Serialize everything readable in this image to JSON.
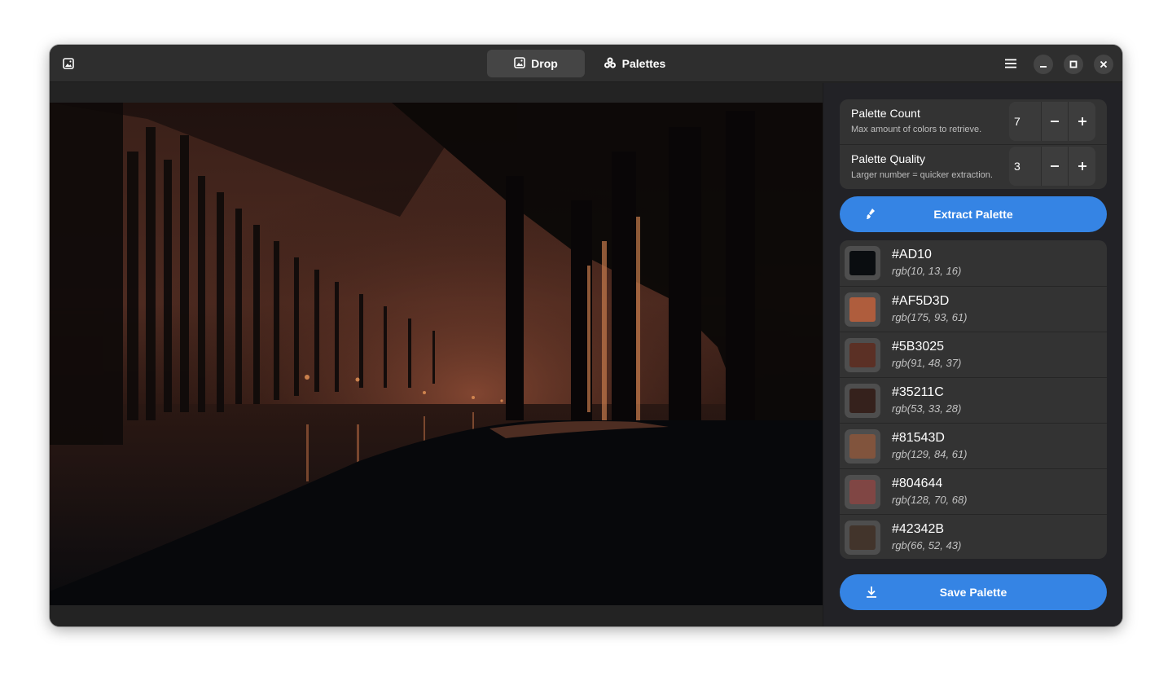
{
  "header": {
    "app_icon": "image-icon",
    "tabs": [
      {
        "label": "Drop",
        "icon": "image-icon",
        "active": true
      },
      {
        "label": "Palettes",
        "icon": "palette-icon",
        "active": false
      }
    ],
    "controls": [
      "menu-icon",
      "minimize-icon",
      "maximize-icon",
      "close-icon"
    ]
  },
  "settings": {
    "count": {
      "title": "Palette Count",
      "subtitle": "Max amount of colors to retrieve.",
      "value": "7"
    },
    "quality": {
      "title": "Palette Quality",
      "subtitle": "Larger number = quicker extraction.",
      "value": "3"
    }
  },
  "actions": {
    "extract_label": "Extract Palette",
    "extract_icon": "brush-icon",
    "save_label": "Save Palette",
    "save_icon": "download-icon"
  },
  "palette": [
    {
      "hex": "#AD10",
      "rgb": "rgb(10, 13, 16)",
      "color": "#0a0d10"
    },
    {
      "hex": "#AF5D3D",
      "rgb": "rgb(175, 93, 61)",
      "color": "#af5d3d"
    },
    {
      "hex": "#5B3025",
      "rgb": "rgb(91, 48, 37)",
      "color": "#5b3025"
    },
    {
      "hex": "#35211C",
      "rgb": "rgb(53, 33, 28)",
      "color": "#35211c"
    },
    {
      "hex": "#81543D",
      "rgb": "rgb(129, 84, 61)",
      "color": "#81543d"
    },
    {
      "hex": "#804644",
      "rgb": "rgb(128, 70, 68)",
      "color": "#804644"
    },
    {
      "hex": "#42342B",
      "rgb": "rgb(66, 52, 43)",
      "color": "#42342b"
    }
  ],
  "colors": {
    "accent": "#3584e4",
    "window_bg": "#242424",
    "card_bg": "#333333"
  }
}
